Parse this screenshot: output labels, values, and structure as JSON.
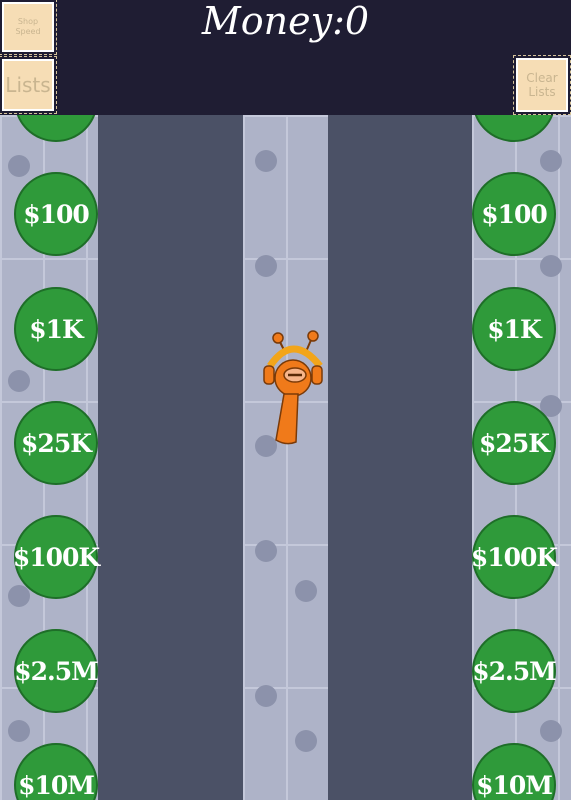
{
  "header": {
    "money_label": "Money:0"
  },
  "buttons": {
    "top_left": "Shop\nSpeed",
    "lists": "Lists",
    "clear_lists": "Clear\nLists"
  },
  "money_buttons_left": [
    "$100",
    "$1K",
    "$25K",
    "$100K",
    "$2.5M",
    "$10M"
  ],
  "money_buttons_right": [
    "$100",
    "$1K",
    "$25K",
    "$100K",
    "$2.5M",
    "$10M"
  ],
  "colors": {
    "header_bg": "#1f1d33",
    "lane_bg": "#4b5166",
    "panel_bg": "#aeb3c8",
    "money_green": "#2f9a3a",
    "character_orange": "#f07a1a"
  },
  "icons": {
    "character": "orange-robot-character"
  }
}
